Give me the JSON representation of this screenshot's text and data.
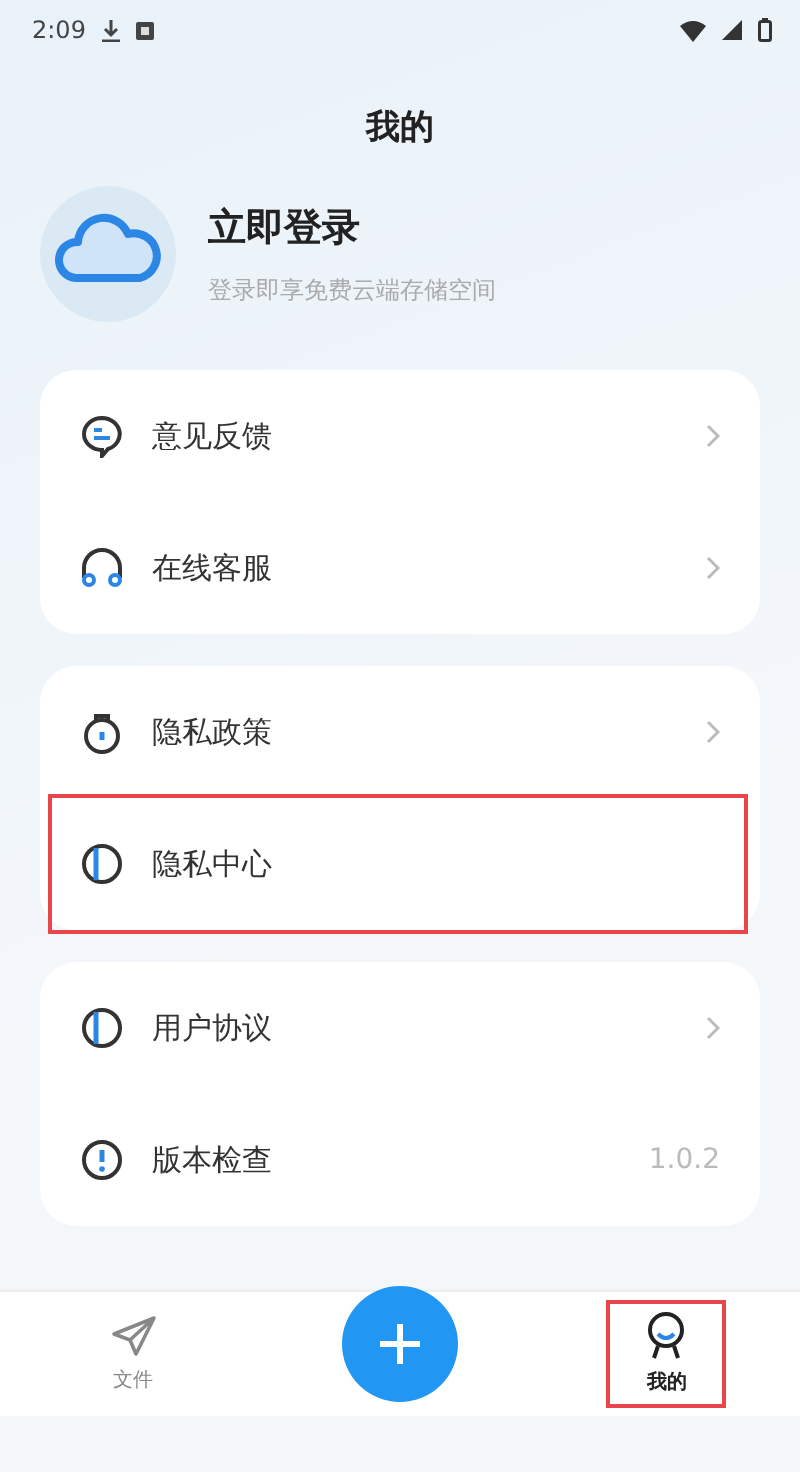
{
  "status_bar": {
    "time": "2:09"
  },
  "header": {
    "title": "我的"
  },
  "profile": {
    "name": "立即登录",
    "subtitle": "登录即享免费云端存储空间"
  },
  "groups": [
    {
      "items": [
        {
          "kind": "chat",
          "label": "意见反馈",
          "chevron": true,
          "highlighted": false
        },
        {
          "kind": "headset",
          "label": "在线客服",
          "chevron": true,
          "highlighted": false
        }
      ]
    },
    {
      "items": [
        {
          "kind": "lock",
          "label": "隐私政策",
          "chevron": true,
          "highlighted": false
        },
        {
          "kind": "shield",
          "label": "隐私中心",
          "chevron": false,
          "highlighted": true
        }
      ]
    },
    {
      "items": [
        {
          "kind": "shield",
          "label": "用户协议",
          "chevron": true,
          "highlighted": false
        },
        {
          "kind": "alert",
          "label": "版本检查",
          "chevron": false,
          "value": "1.0.2",
          "highlighted": false
        }
      ]
    }
  ],
  "bottom_nav": [
    {
      "kind": "files",
      "label": "文件",
      "selected": false,
      "highlighted": false
    },
    {
      "kind": "add",
      "highlighted": false
    },
    {
      "kind": "me",
      "label": "我的",
      "selected": true,
      "highlighted": true
    }
  ]
}
